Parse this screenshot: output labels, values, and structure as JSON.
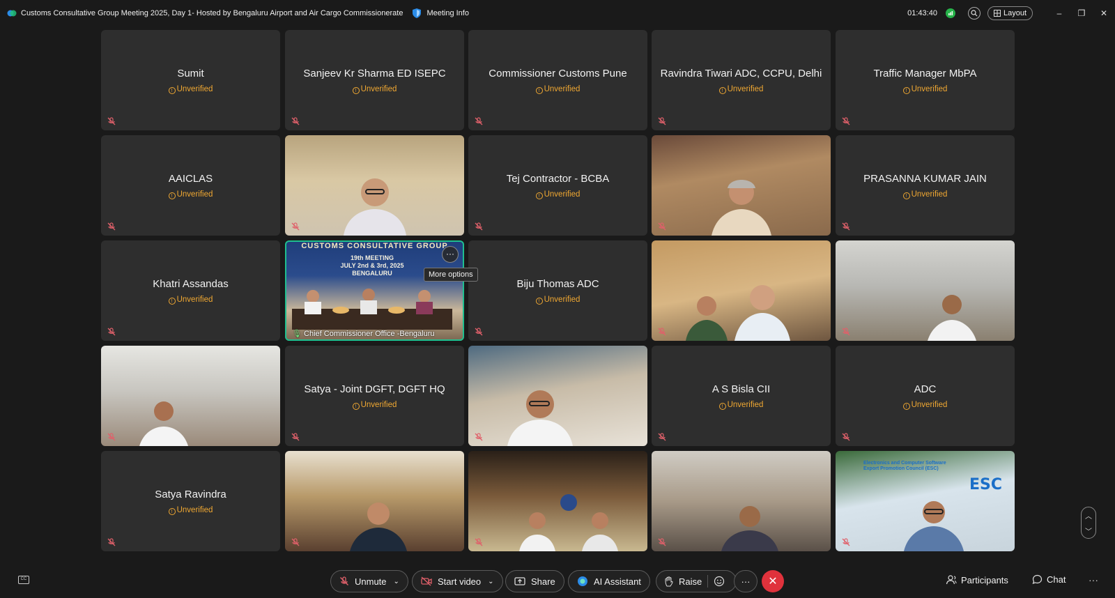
{
  "window": {
    "title": "Customs Consultative Group Meeting 2025, Day 1- Hosted by Bengaluru Airport and Air Cargo Commissionerate",
    "meeting_info": "Meeting Info",
    "timer": "01:43:40",
    "layout_label": "Layout",
    "minimize": "–",
    "restore": "❐",
    "close": "✕"
  },
  "unverified_label": "Unverified",
  "tiles": [
    {
      "name": "Sumit",
      "unverified": true
    },
    {
      "name": "Sanjeev Kr Sharma ED ISEPC",
      "unverified": true
    },
    {
      "name": "Commissioner Customs Pune",
      "unverified": true
    },
    {
      "name": "Ravindra Tiwari ADC, CCPU, Delhi",
      "unverified": true
    },
    {
      "name": "Traffic Manager MbPA",
      "unverified": true
    },
    {
      "name": "AAICLAS",
      "unverified": true
    },
    {
      "name": "",
      "video": true
    },
    {
      "name": "Tej Contractor - BCBA",
      "unverified": true
    },
    {
      "name": "",
      "video": true
    },
    {
      "name": "PRASANNA KUMAR JAIN",
      "unverified": true
    },
    {
      "name": "Khatri Assandas",
      "unverified": true
    },
    {
      "name": "Chief Commissioner Office -Bengaluru",
      "video": true,
      "active": true
    },
    {
      "name": "Biju Thomas ADC",
      "unverified": true
    },
    {
      "name": "",
      "video": true
    },
    {
      "name": "",
      "video": true
    },
    {
      "name": "",
      "video": true
    },
    {
      "name": "Satya - Joint DGFT, DGFT HQ",
      "unverified": true
    },
    {
      "name": "",
      "video": true
    },
    {
      "name": "A S Bisla CII",
      "unverified": true
    },
    {
      "name": "ADC",
      "unverified": true
    },
    {
      "name": "Satya Ravindra",
      "unverified": true
    },
    {
      "name": "",
      "video": true
    },
    {
      "name": "",
      "video": true
    },
    {
      "name": "",
      "video": true
    },
    {
      "name": "",
      "video": true
    }
  ],
  "banner": {
    "heading": "CUSTOMS CONSULTATIVE GROUP",
    "line1": "19th MEETING",
    "line2": "JULY 2nd & 3rd, 2025",
    "line3": "BENGALURU"
  },
  "esc": {
    "logo": "ESC",
    "text": "Electronics and Computer Software Export Promotion Council (ESC)"
  },
  "more_options_tooltip": "More options",
  "more_options_glyph": "···",
  "toolbar": {
    "unmute": "Unmute",
    "start_video": "Start video",
    "share": "Share",
    "ai_assistant": "AI Assistant",
    "raise": "Raise",
    "more": "···",
    "end": "✕",
    "participants": "Participants",
    "chat": "Chat",
    "overflow": "···"
  },
  "colors": {
    "accent_green": "#1fbf8f",
    "warning": "#f0a832",
    "end_call": "#e0323c",
    "status_green": "#27b34a"
  }
}
